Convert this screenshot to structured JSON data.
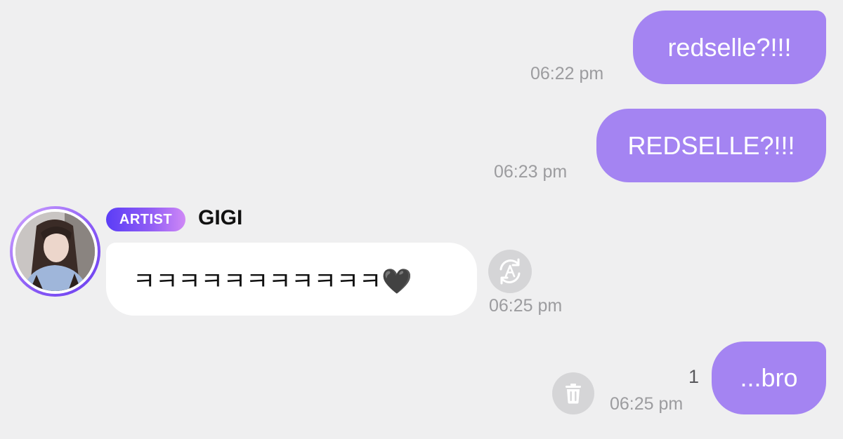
{
  "messages": [
    {
      "text": "redselle?!!!",
      "time": "06:22 pm"
    },
    {
      "text": "REDSELLE?!!!",
      "time": "06:23 pm"
    },
    {
      "badge": "ARTIST",
      "sender": "GIGI",
      "text": "ㅋㅋㅋㅋㅋㅋㅋㅋㅋㅋㅋ🖤",
      "time": "06:25 pm",
      "icon": "translate-icon"
    },
    {
      "text": "...bro",
      "time": "06:25 pm",
      "unread_count": "1",
      "icon": "trash-icon"
    }
  ],
  "colors": {
    "outgoing_bubble": "#a484f2",
    "incoming_bubble": "#ffffff",
    "background": "#efeff0",
    "timestamp": "#9c9c9f",
    "badge_gradient_start": "#5b3df6",
    "badge_gradient_end": "#cf88f6"
  }
}
